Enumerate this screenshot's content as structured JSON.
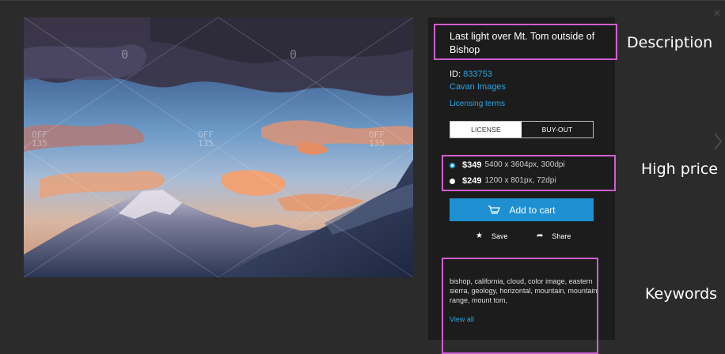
{
  "image": {
    "alt": "Mountain peaks at sunset",
    "watermark_text": "0",
    "watermark_off": "OFF",
    "watermark_num": "135"
  },
  "panel": {
    "title": "Last light over Mt. Tom outside of Bishop",
    "id_label": "ID:",
    "id_value": "833753",
    "agency": "Cavan Images",
    "licensing_link": "Licensing terms",
    "tabs": [
      "LICENSE",
      "BUY-OUT"
    ],
    "prices": [
      {
        "amount": "$349",
        "detail": "5400 x 3604px, 300dpi",
        "selected": true
      },
      {
        "amount": "$249",
        "detail": "1200 x 801px, 72dpi",
        "selected": false
      }
    ],
    "add_to_cart": "Add to cart",
    "save": "Save",
    "share": "Share",
    "keywords": "bishop, california, cloud, color image, eastern sierra, geology, horizontal, mountain, mountain range, mount tom,",
    "view_all": "View all"
  },
  "annotations": {
    "description": "Description",
    "high_price": "High price",
    "keywords": "Keywords"
  },
  "colors": {
    "background": "#2b2b2b",
    "panel": "#1c1c1c",
    "accent": "#1e90d2",
    "link": "#2aa4e0",
    "highlight": "#d05fd0"
  }
}
